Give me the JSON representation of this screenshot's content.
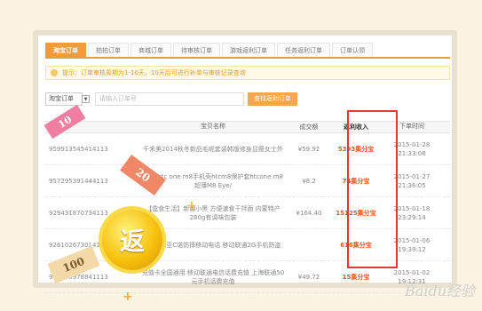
{
  "tabs": [
    "淘宝订单",
    "拍拍订单",
    "商城订单",
    "待审核订单",
    "游戏返利订单",
    "任务返利订单",
    "订单认领"
  ],
  "notice": "提示：订单审核周期为1-10天，10天后可进行补单与审核记录查询",
  "search": {
    "select_label": "淘宝订单",
    "input_placeholder": "请输入订单号",
    "button_label": "查找返利订单"
  },
  "table": {
    "headers": [
      "",
      "宝贝名称",
      "成交额",
      "返利收入",
      "下单时间"
    ],
    "rows": [
      {
        "id": "959913545414113",
        "name": "千禾美2014秋冬新品毛呢套装韩版修身显瘦女士外",
        "price": "¥59.92",
        "rebate": "5393集分宝",
        "date": "2015-01-28",
        "time": "21:33:08"
      },
      {
        "id": "957295391444113",
        "name": "HTC htc one m8手机壳htcm8保护套htcone m8超薄M8 Eye/",
        "price": "¥8.2",
        "rebate": "74集分宝",
        "date": "2015-01-27",
        "time": "21:36:05"
      },
      {
        "id": "929431870734113",
        "name": "【盒食生活】新疆小黑 方便速食干拌面 内蒙特产 280g有调味包装",
        "price": "¥164.40",
        "rebate": "15125集分宝",
        "date": "2015-01-18",
        "time": "23:29:14"
      },
      {
        "id": "926102673014113",
        "name": "ZC诺基亚C诺防摔移动电话 移动联通2G手机防盗",
        "price": "",
        "rebate": "616集分宝",
        "date": "2015-01-06",
        "time": "19:39:12"
      },
      {
        "id": "910158978841113",
        "name": "充值卡全国通用 移动联通电信话费充值 上海联通50元手机话费充值",
        "price": "¥49.72",
        "rebate": "15集分宝",
        "date": "2015-01-02",
        "time": "19:12:31"
      }
    ]
  },
  "decor": {
    "r10": "10",
    "r20": "20",
    "r100": "100",
    "coin": "返",
    "watermark": "Baidu经验"
  }
}
